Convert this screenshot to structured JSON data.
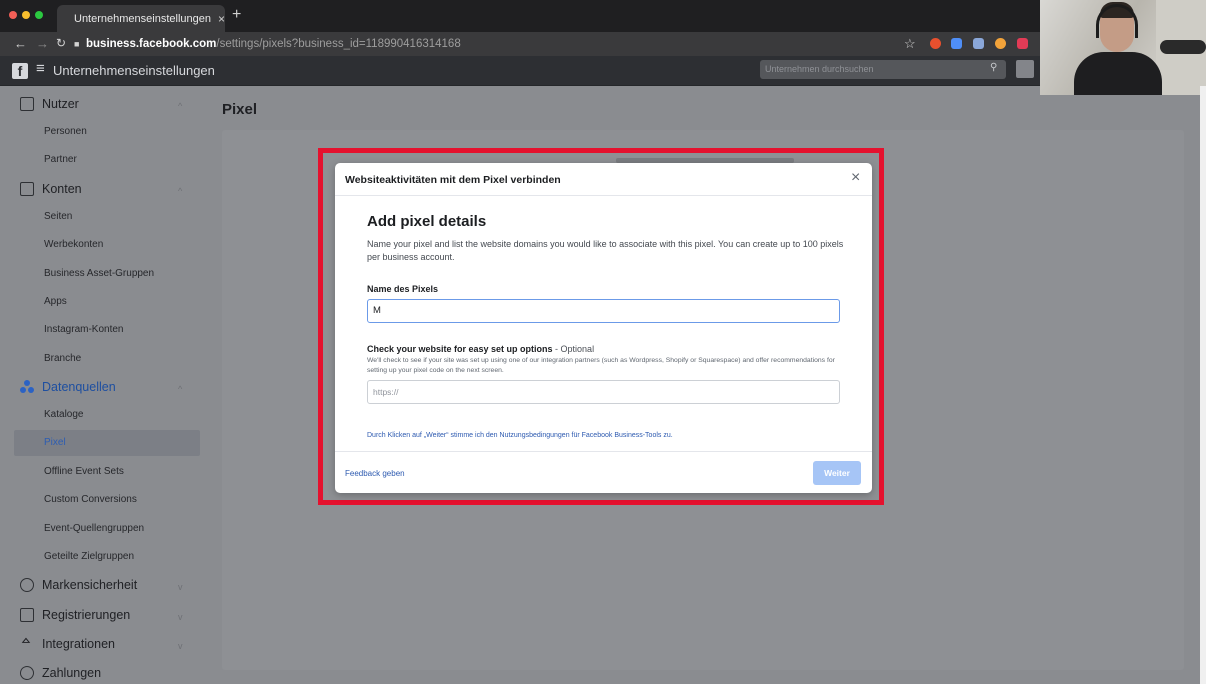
{
  "browser": {
    "tab_title": "Unternehmenseinstellungen",
    "tab_close": "×",
    "new_tab": "+",
    "url_host": "business.facebook.com",
    "url_path": "/settings/pixels?business_id=118990416314168",
    "icons": [
      "back-icon",
      "forward-icon",
      "reload-icon",
      "lock-icon",
      "star-icon"
    ]
  },
  "header": {
    "logo": "f",
    "title": "Unternehmenseinstellungen",
    "search_placeholder": "Unternehmen durchsuchen"
  },
  "sidebar": {
    "sections": [
      {
        "label": "Nutzer",
        "icon": "people-icon",
        "items": [
          "Personen",
          "Partner"
        ]
      },
      {
        "label": "Konten",
        "icon": "accounts-icon",
        "items": [
          "Seiten",
          "Werbekonten",
          "Business Asset-Gruppen",
          "Apps",
          "Instagram-Konten",
          "Branche"
        ]
      },
      {
        "label": "Datenquellen",
        "icon": "datasources-icon",
        "items": [
          "Kataloge",
          "Pixel",
          "Offline Event Sets",
          "Custom Conversions",
          "Event-Quellengruppen",
          "Geteilte Zielgruppen"
        ]
      },
      {
        "label": "Markensicherheit",
        "icon": "shield-icon",
        "items": []
      },
      {
        "label": "Registrierungen",
        "icon": "clipboard-icon",
        "items": []
      },
      {
        "label": "Integrationen",
        "icon": "integrations-icon",
        "items": []
      },
      {
        "label": "Zahlungen",
        "icon": "payments-icon",
        "items": []
      }
    ],
    "active_item": "Pixel"
  },
  "main": {
    "title": "Pixel"
  },
  "dialog": {
    "title": "Websiteaktivitäten mit dem Pixel verbinden",
    "close": "×",
    "heading": "Add pixel details",
    "description": "Name your pixel and list the website domains you would like to associate with this pixel. You can create up to 100 pixels per business account.",
    "name_label": "Name des Pixels",
    "name_value": "M",
    "check_label": "Check your website for easy set up options",
    "check_optional": " - Optional",
    "check_description": "We'll check to see if your site was set up using one of our integration partners (such as Wordpress, Shopify or Squarespace) and offer recommendations for setting up your pixel code on the next screen.",
    "url_placeholder": "https://",
    "terms": "Durch Klicken auf „Weiter“ stimme ich den Nutzungsbedingungen für Facebook Business-Tools zu.",
    "feedback": "Feedback geben",
    "next_button": "Weiter"
  },
  "colors": {
    "highlight": "#e5112e",
    "link": "#2d5ab0",
    "button_disabled": "#a6c5f6"
  }
}
